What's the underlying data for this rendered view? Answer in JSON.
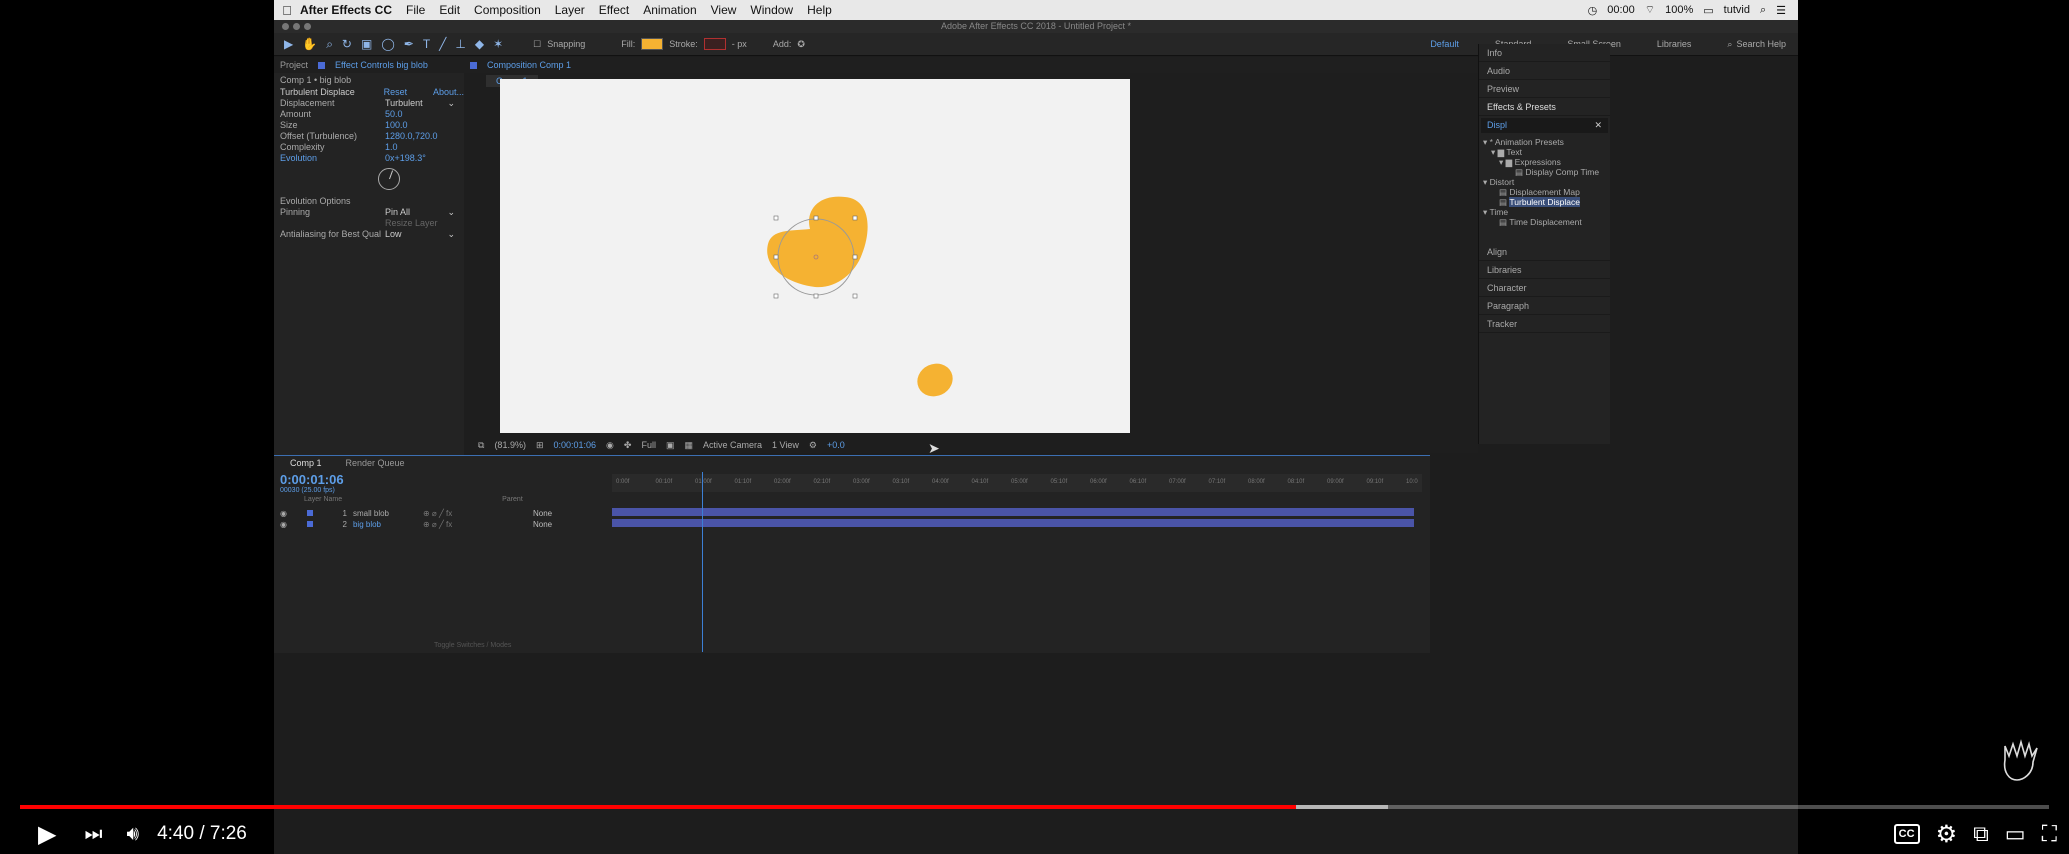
{
  "menubar": {
    "app_name": "After Effects CC",
    "items": [
      "File",
      "Edit",
      "Composition",
      "Layer",
      "Effect",
      "Animation",
      "View",
      "Window",
      "Help"
    ],
    "clock": "00:00",
    "battery": "100%",
    "user": "tutvid"
  },
  "window": {
    "title": "Adobe After Effects CC 2018 - Untitled Project *"
  },
  "toolbar": {
    "snapping_label": "Snapping",
    "fill_label": "Fill:",
    "stroke_label": "Stroke:",
    "stroke_px": "- px",
    "add_label": "Add:",
    "fill_color": "#f5b232",
    "stroke_color": "#b03030",
    "workspaces": [
      "Default",
      "Standard",
      "Small Screen",
      "Libraries"
    ],
    "search_placeholder": "Search Help"
  },
  "effect_controls": {
    "tab_project": "Project",
    "tab_effect": "Effect Controls big blob",
    "subtitle": "Comp 1 • big blob",
    "effect_name": "Turbulent Displace",
    "reset": "Reset",
    "about": "About...",
    "rows": [
      {
        "label": "Displacement",
        "value": "Turbulent"
      },
      {
        "label": "Amount",
        "value": "50.0"
      },
      {
        "label": "Size",
        "value": "100.0"
      },
      {
        "label": "Offset (Turbulence)",
        "value": "1280.0,720.0"
      },
      {
        "label": "Complexity",
        "value": "1.0"
      },
      {
        "label": "Evolution",
        "value": "0x+198.3°"
      }
    ],
    "evolution_options": "Evolution Options",
    "pinning_label": "Pinning",
    "pinning_value": "Pin All",
    "resize_layer": "Resize Layer",
    "antialias_label": "Antialiasing for Best Qual",
    "antialias_value": "Low"
  },
  "composition": {
    "tab": "Composition Comp 1",
    "subtab": "Comp 1",
    "footer": {
      "zoom": "(81.9%)",
      "timecode": "0:00:01:06",
      "resolution": "Full",
      "camera": "Active Camera",
      "views": "1 View",
      "exposure": "+0.0"
    },
    "blob_color": "#f5b232"
  },
  "right_panel": {
    "info": "Info",
    "audio": "Audio",
    "preview": "Preview",
    "effects_presets": "Effects & Presets",
    "search_value": "Displ",
    "tree": [
      {
        "label": "* Animation Presets",
        "indent": 0
      },
      {
        "label": "Text",
        "indent": 1
      },
      {
        "label": "Expressions",
        "indent": 2
      },
      {
        "label": "Display Comp Time",
        "indent": 3
      },
      {
        "label": "Distort",
        "indent": 0
      },
      {
        "label": "Displacement Map",
        "indent": 2
      },
      {
        "label": "Turbulent Displace",
        "indent": 2,
        "highlight": true
      },
      {
        "label": "Time",
        "indent": 0
      },
      {
        "label": "Time Displacement",
        "indent": 2
      }
    ],
    "other_panels": [
      "Align",
      "Libraries",
      "Character",
      "Paragraph",
      "Tracker"
    ]
  },
  "timeline": {
    "tab_comp": "Comp 1",
    "tab_render": "Render Queue",
    "timecode": "0:00:01:06",
    "fps": "00030 (25.00 fps)",
    "header_layer": "Layer Name",
    "header_parent": "Parent",
    "layers": [
      {
        "num": "1",
        "name": "small blob",
        "parent": "None"
      },
      {
        "num": "2",
        "name": "big blob",
        "parent": "None"
      }
    ],
    "ruler_ticks": [
      "0:00f",
      "00:10f",
      "01:00f",
      "01:10f",
      "02:00f",
      "02:10f",
      "03:00f",
      "03:10f",
      "04:00f",
      "04:10f",
      "05:00f",
      "05:10f",
      "06:00f",
      "06:10f",
      "07:00f",
      "07:10f",
      "08:00f",
      "08:10f",
      "09:00f",
      "09:10f",
      "10:0"
    ],
    "bottom_label": "Toggle Switches / Modes"
  },
  "video": {
    "current_time": "4:40",
    "duration": "7:26",
    "time_display": "4:40 / 7:26",
    "played_fraction": 0.629,
    "buffered_fraction": 0.674
  }
}
